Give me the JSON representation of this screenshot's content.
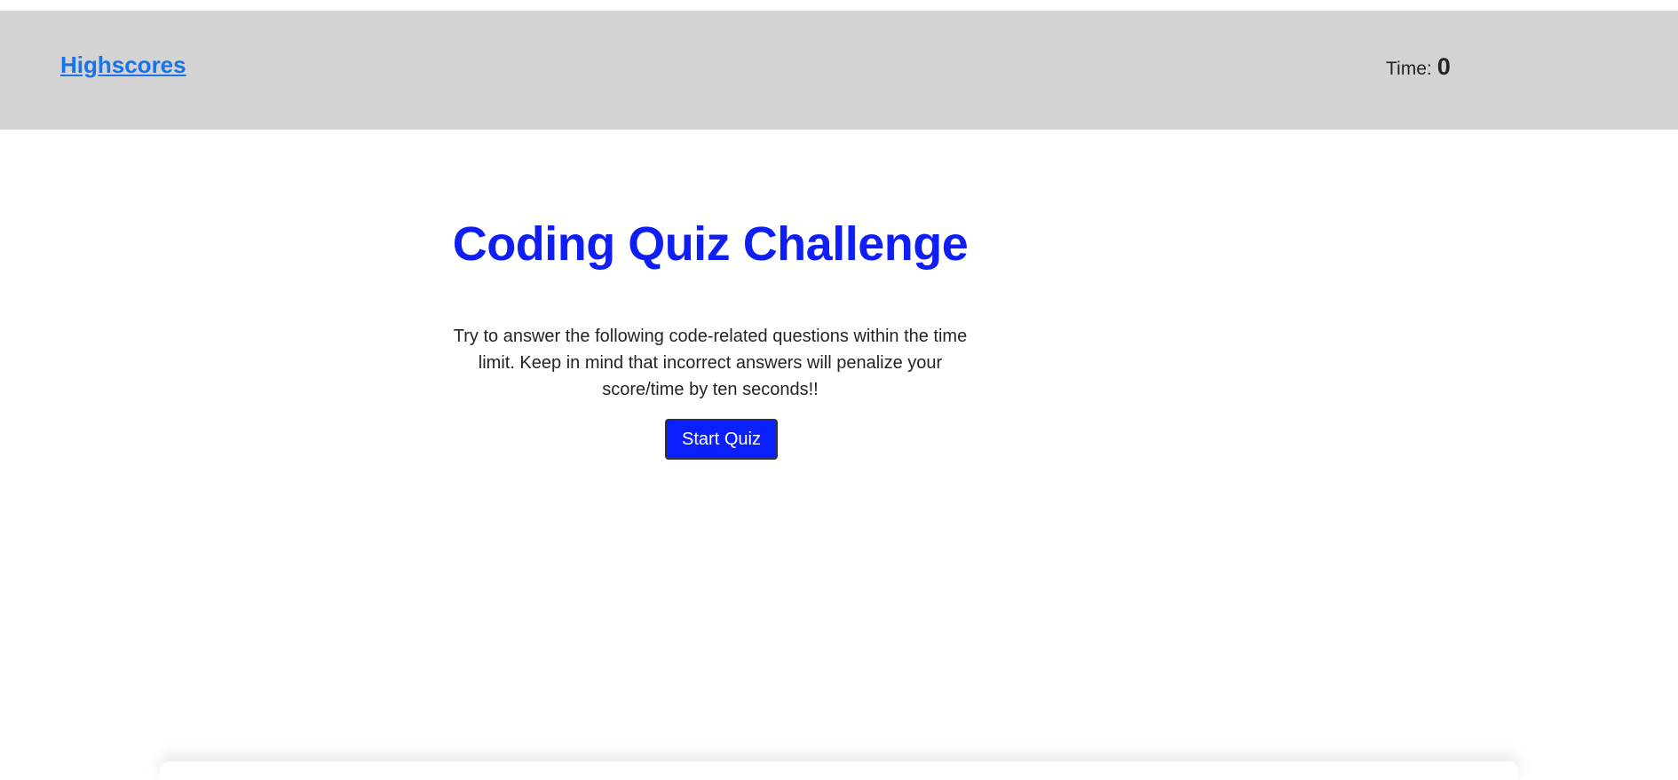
{
  "header": {
    "highscores_label": "Highscores",
    "time_label": "Time:",
    "time_value": "0"
  },
  "main": {
    "title": "Coding Quiz Challenge",
    "description": "Try to answer the following code-related questions within the time limit. Keep in mind that incorrect answers will penalize your score/time by ten seconds!!",
    "start_button_label": "Start Quiz"
  },
  "colors": {
    "header_bg": "#d3d3d3",
    "link": "#1a73e8",
    "title": "#0e1ef5",
    "button_bg": "#0a1ffd"
  }
}
